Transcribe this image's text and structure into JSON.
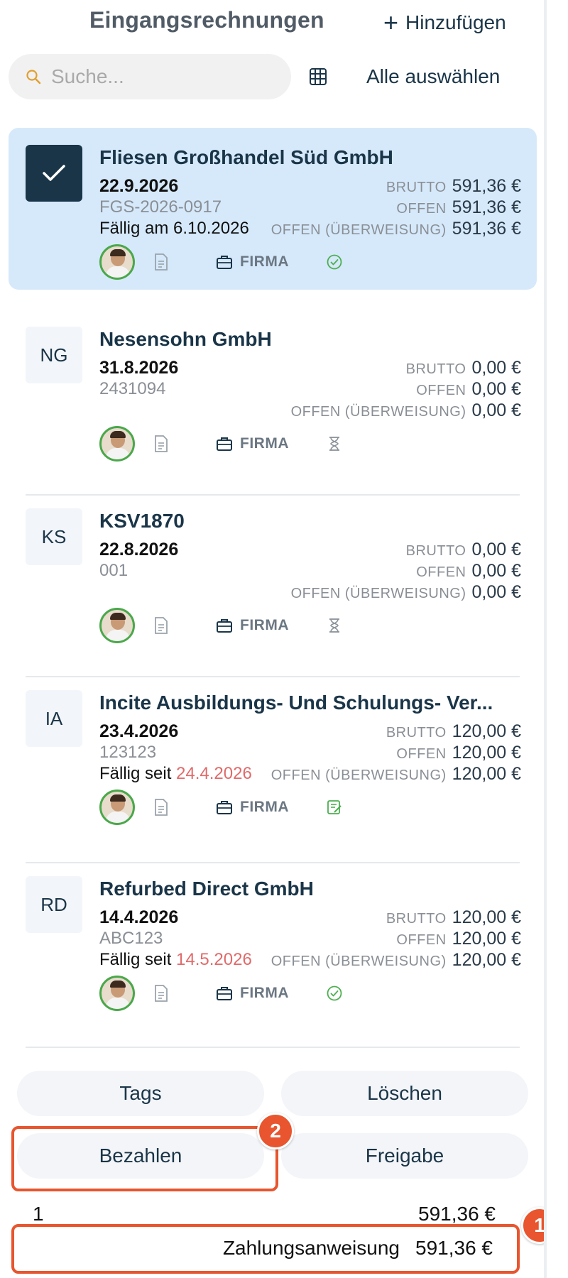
{
  "header": {
    "title": "Eingangsrechnungen",
    "add_label": "Hinzufügen",
    "search_placeholder": "Suche...",
    "select_all_label": "Alle auswählen"
  },
  "amount_labels": {
    "brutto": "BRUTTO",
    "offen": "OFFEN",
    "offen_ueberweisung": "OFFEN (ÜBERWEISUNG)"
  },
  "invoices": [
    {
      "initials": "",
      "selected": true,
      "name": "Fliesen Großhandel Süd GmbH",
      "date": "22.9.2026",
      "ref": "FGS-2026-0917",
      "due_prefix": "Fällig am",
      "due_date": "6.10.2026",
      "due_overdue": false,
      "brutto": "591,36 €",
      "offen": "591,36 €",
      "offen_ueberweisung": "591,36 €",
      "tag": "FIRMA",
      "status_icon": "check-circle-icon"
    },
    {
      "initials": "NG",
      "selected": false,
      "name": "Nesensohn GmbH",
      "date": "31.8.2026",
      "ref": "2431094",
      "due_prefix": "",
      "due_date": "",
      "due_overdue": false,
      "brutto": "0,00 €",
      "offen": "0,00 €",
      "offen_ueberweisung": "0,00 €",
      "tag": "FIRMA",
      "status_icon": "hourglass-icon"
    },
    {
      "initials": "KS",
      "selected": false,
      "name": "KSV1870",
      "date": "22.8.2026",
      "ref": "001",
      "due_prefix": "",
      "due_date": "",
      "due_overdue": false,
      "brutto": "0,00 €",
      "offen": "0,00 €",
      "offen_ueberweisung": "0,00 €",
      "tag": "FIRMA",
      "status_icon": "hourglass-icon"
    },
    {
      "initials": "IA",
      "selected": false,
      "name": "Incite Ausbildungs- Und Schulungs- Ver...",
      "date": "23.4.2026",
      "ref": "123123",
      "due_prefix": "Fällig seit",
      "due_date": "24.4.2026",
      "due_overdue": true,
      "brutto": "120,00 €",
      "offen": "120,00 €",
      "offen_ueberweisung": "120,00 €",
      "tag": "FIRMA",
      "status_icon": "approval-note-icon"
    },
    {
      "initials": "RD",
      "selected": false,
      "name": "Refurbed Direct GmbH",
      "date": "14.4.2026",
      "ref": "ABC123",
      "due_prefix": "Fällig seit",
      "due_date": "14.5.2026",
      "due_overdue": true,
      "brutto": "120,00 €",
      "offen": "120,00 €",
      "offen_ueberweisung": "120,00 €",
      "tag": "FIRMA",
      "status_icon": "check-circle-icon"
    }
  ],
  "actions": {
    "tags": "Tags",
    "delete": "Löschen",
    "pay": "Bezahlen",
    "approve": "Freigabe"
  },
  "summary": {
    "count": "1",
    "total": "591,36 €",
    "payment_label": "Zahlungsanweisung",
    "payment_amount": "591,36 €"
  },
  "annotations": {
    "badge_1": "1",
    "badge_2": "2"
  },
  "colors": {
    "primary": "#1a3548",
    "selected_bg": "#d6e9fb",
    "highlight": "#e8552e",
    "overdue": "#e06a6a",
    "status_ok": "#4caf50"
  }
}
